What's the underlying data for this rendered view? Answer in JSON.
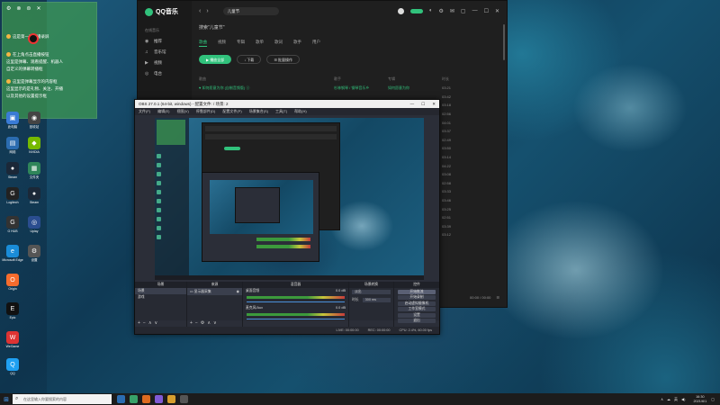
{
  "chat": {
    "lines": [
      "这是第一场直播录屏",
      "在上角点击直播按钮",
      "这里是弹幕、观看提醒、机器人",
      "自定义的弹幕转播框",
      "这里是弹幕显示的内容框",
      "这里显示的是礼物、关注、开播",
      "以及其他的设置提示框"
    ]
  },
  "desktop_icons": [
    {
      "label": "此电脑",
      "color": "#3a7bd5",
      "glyph": "▣"
    },
    {
      "label": "回收站",
      "color": "#444",
      "glyph": "◉"
    },
    {
      "label": "网络",
      "color": "#2b6cb0",
      "glyph": "▤"
    },
    {
      "label": "NVIDIA",
      "color": "#76b900",
      "glyph": "◆"
    },
    {
      "label": "Steam",
      "color": "#1b2838",
      "glyph": "●"
    },
    {
      "label": "文件夹",
      "color": "#2f855a",
      "glyph": "▦"
    },
    {
      "label": "Logitech",
      "color": "#222",
      "glyph": "G"
    },
    {
      "label": "Steam",
      "color": "#1b2838",
      "glyph": "●"
    },
    {
      "label": "G HUB",
      "color": "#333",
      "glyph": "G"
    },
    {
      "label": "Uplay",
      "color": "#2a4d8f",
      "glyph": "◎"
    },
    {
      "label": "Microsoft Edge",
      "color": "#1a8cd8",
      "glyph": "e"
    },
    {
      "label": "设置",
      "color": "#555",
      "glyph": "⚙"
    },
    {
      "label": "Origin",
      "color": "#f56c2d",
      "glyph": "O"
    },
    {
      "label": "Epic",
      "color": "#111",
      "glyph": "E"
    },
    {
      "label": "WeGame",
      "color": "#d33",
      "glyph": "W"
    },
    {
      "label": "QQ",
      "color": "#1fa0f2",
      "glyph": "Q"
    }
  ],
  "qq": {
    "app_name": "QQ音乐",
    "search_value": "儿童节",
    "sidebar_head": "在线音乐",
    "sidebar_items": [
      {
        "icon": "◉",
        "label": "推荐"
      },
      {
        "icon": "♫",
        "label": "音乐馆"
      },
      {
        "icon": "▶",
        "label": "视频"
      },
      {
        "icon": "◎",
        "label": "电台"
      }
    ],
    "result_title": "搜索\"儿童节\"",
    "tabs": [
      "歌曲",
      "视频",
      "专辑",
      "歌单",
      "歌词",
      "歌手",
      "用户"
    ],
    "actions": [
      "▶ 播放全部",
      "↓ 下载",
      "☰ 批量操作"
    ],
    "columns": [
      "歌曲",
      "歌手",
      "专辑",
      "时长"
    ],
    "rows": [
      {
        "song": "♥ 如何愿意为你 (自制音频版) ⓢ",
        "singer": "杉林钢琴 / 钢琴音乐乡",
        "album": "如何愿意为你",
        "duration": "03:21",
        "active": true
      },
      {
        "song": "",
        "singer": "",
        "album": "",
        "duration": "03:42"
      },
      {
        "song": "",
        "singer": "",
        "album": "",
        "duration": "03:18"
      },
      {
        "song": "",
        "singer": "",
        "album": "",
        "duration": "02:56"
      },
      {
        "song": "",
        "singer": "",
        "album": "",
        "duration": "04:01"
      },
      {
        "song": "",
        "singer": "",
        "album": "",
        "duration": "03:37"
      },
      {
        "song": "",
        "singer": "",
        "album": "",
        "duration": "02:49"
      },
      {
        "song": "",
        "singer": "",
        "album": "",
        "duration": "03:50"
      },
      {
        "song": "",
        "singer": "",
        "album": "",
        "duration": "03:14"
      },
      {
        "song": "",
        "singer": "",
        "album": "",
        "duration": "04:22"
      },
      {
        "song": "",
        "singer": "",
        "album": "",
        "duration": "03:08"
      },
      {
        "song": "",
        "singer": "",
        "album": "",
        "duration": "02:58"
      },
      {
        "song": "",
        "singer": "",
        "album": "",
        "duration": "03:33"
      },
      {
        "song": "",
        "singer": "",
        "album": "",
        "duration": "03:46"
      },
      {
        "song": "",
        "singer": "",
        "album": "",
        "duration": "03:25"
      },
      {
        "song": "",
        "singer": "",
        "album": "",
        "duration": "02:51"
      },
      {
        "song": "",
        "singer": "",
        "album": "",
        "duration": "03:39"
      },
      {
        "song": "",
        "singer": "",
        "album": "",
        "duration": "03:12"
      }
    ],
    "player_text": "00:00 / 00:00"
  },
  "obs": {
    "title": "OBS 27.0.1 (64-bit, windows) - 配置文件: / 场景: 2",
    "window_controls": [
      "—",
      "☐",
      "✕"
    ],
    "menu": [
      "文件(F)",
      "编辑(E)",
      "视图(V)",
      "停靠部件(D)",
      "配置文件(P)",
      "场景集合(S)",
      "工具(T)",
      "帮助(H)"
    ],
    "docks": {
      "scenes": {
        "title": "场景",
        "items": [
          "场景",
          "游戏"
        ]
      },
      "sources": {
        "title": "来源",
        "items": [
          "显示器采集"
        ]
      },
      "mixer": {
        "title": "混音器",
        "tracks": [
          {
            "name": "桌面音频",
            "level": "0.0 dB"
          },
          {
            "name": "麦克风/Aux",
            "level": "0.0 dB"
          }
        ]
      },
      "transitions": {
        "title": "场景转换",
        "type_label": "淡出",
        "duration_label": "时长",
        "duration_value": "300 ms"
      },
      "controls": {
        "title": "控件",
        "buttons": [
          "开始推流",
          "开始录制",
          "启动虚拟摄像机",
          "工作室模式",
          "设置",
          "退出"
        ]
      }
    },
    "status": [
      "LIVE: 00:00:00",
      "REC: 00:00:00",
      "CPU: 2.4%, 60.00 fps"
    ]
  },
  "taskbar": {
    "search_placeholder": "在这里输入你要搜索的内容",
    "apps_colors": [
      "#2b6cb0",
      "#38a169",
      "#dd6b20",
      "#805ad5",
      "#d69e2e",
      "#555"
    ],
    "tray_items": [
      "∧",
      "☁",
      "英",
      "◀)"
    ],
    "time": "16:30",
    "date": "2021/6/1"
  }
}
